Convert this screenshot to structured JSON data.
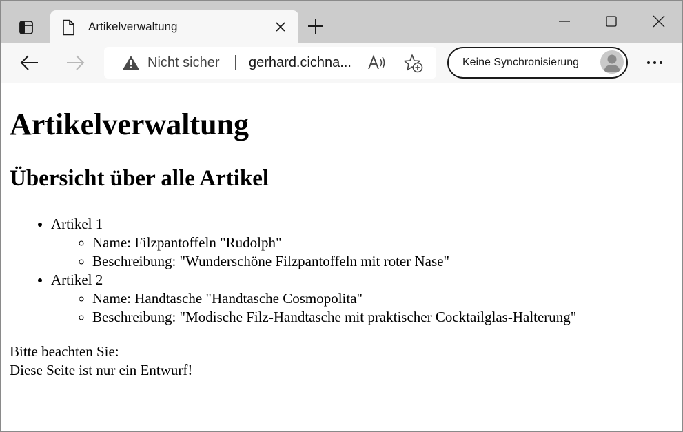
{
  "browser": {
    "tab": {
      "title": "Artikelverwaltung"
    },
    "address": {
      "security_label": "Nicht sicher",
      "url": "gerhard.cichna..."
    },
    "profile": {
      "sync_label": "Keine Synchronisierung"
    },
    "icons": {
      "tab_actions": "tab-actions-icon",
      "page": "page-icon",
      "close": "close-icon",
      "new_tab": "plus-icon",
      "back": "arrow-left-icon",
      "forward": "arrow-right-icon",
      "warning": "warning-icon",
      "read_aloud": "read-aloud-icon",
      "favorite": "add-favorite-icon",
      "more": "more-icon"
    }
  },
  "page": {
    "heading": "Artikelverwaltung",
    "subheading": "Übersicht über alle Artikel",
    "articles": [
      {
        "label": "Artikel 1",
        "name": "Name: Filzpantoffeln \"Rudolph\"",
        "description": "Beschreibung: \"Wunderschöne Filzpantoffeln mit roter Nase\""
      },
      {
        "label": "Artikel 2",
        "name": "Name: Handtasche \"Handtasche Cosmopolita\"",
        "description": "Beschreibung: \"Modische Filz-Handtasche mit praktischer Cocktailglas-Halterung\""
      }
    ],
    "notice_line1": "Bitte beachten Sie:",
    "notice_line2": "Diese Seite ist nur ein Entwurf!"
  }
}
